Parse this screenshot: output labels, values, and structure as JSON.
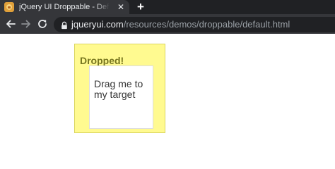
{
  "browser": {
    "tab": {
      "title": "jQuery UI Droppable - Default functionality",
      "favicon": "jquery-ui-favicon"
    },
    "icons": {
      "close": "close-icon",
      "new_tab": "plus-icon",
      "back": "arrow-left-icon",
      "forward": "arrow-right-icon",
      "reload": "reload-icon",
      "lock": "lock-icon"
    },
    "address": {
      "host": "jqueryui.com",
      "path": "/resources/demos/droppable/default.html"
    }
  },
  "demo": {
    "droppable_label": "Dropped!",
    "draggable_label": "Drag me to my target"
  },
  "colors": {
    "droppable_bg": "#fffa90",
    "droppable_border": "#dad55e",
    "droppable_text": "#777620"
  }
}
